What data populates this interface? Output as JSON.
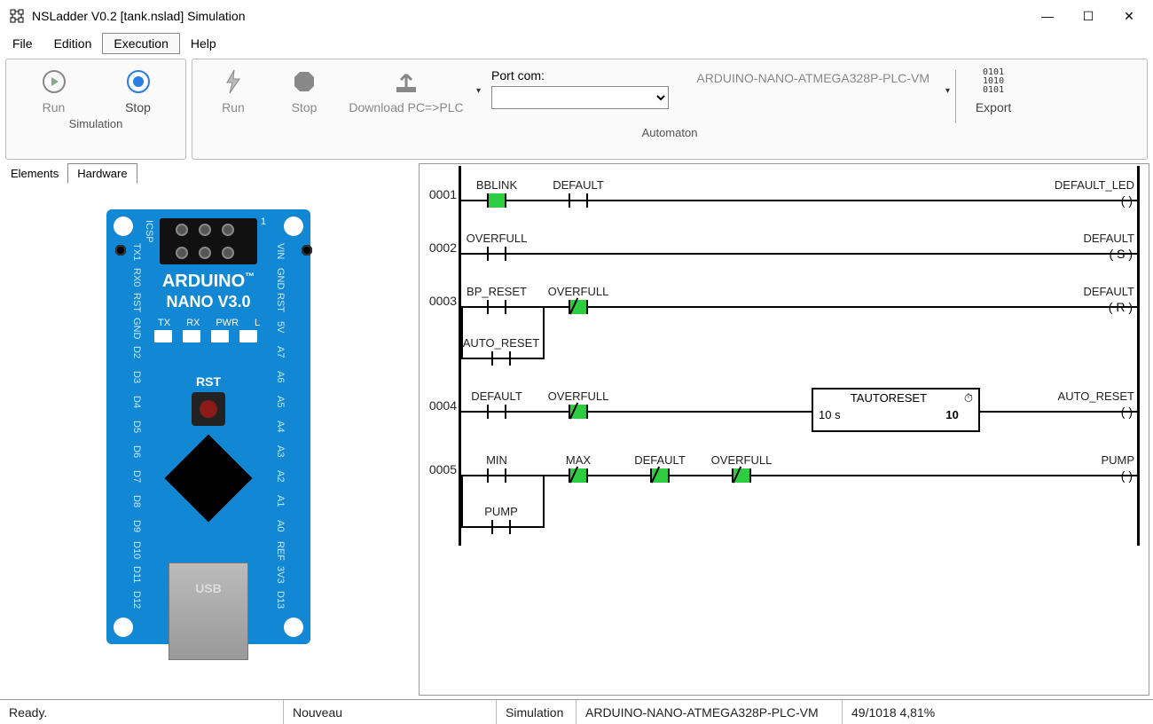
{
  "title": "NSLadder V0.2  [tank.nslad] Simulation",
  "menu": [
    "File",
    "Edition",
    "Execution",
    "Help"
  ],
  "menu_active": 2,
  "ribbon": {
    "sim": {
      "run": "Run",
      "stop": "Stop",
      "label": "Simulation"
    },
    "auto": {
      "run": "Run",
      "stop": "Stop",
      "download": "Download PC=>PLC",
      "portlbl": "Port com:",
      "hw": "ARDUINO-NANO-ATMEGA328P-PLC-VM",
      "export": "Export",
      "label": "Automaton"
    }
  },
  "tabs": [
    "Elements",
    "Hardware"
  ],
  "tab_active": 1,
  "board": {
    "name": "ARDUINO",
    "sub": "NANO V3.0",
    "rst": "RST",
    "usb": "USB",
    "tm": "™"
  },
  "ladder": {
    "rungs": [
      {
        "n": "0001",
        "left": [
          {
            "t": "NO",
            "lbl": "BBLINK",
            "on": true
          },
          {
            "t": "NO",
            "lbl": "DEFAULT"
          }
        ],
        "coil": {
          "t": "()",
          "lbl": "DEFAULT_LED"
        }
      },
      {
        "n": "0002",
        "left": [
          {
            "t": "NO",
            "lbl": "OVERFULL"
          }
        ],
        "coil": {
          "t": "(S)",
          "lbl": "DEFAULT"
        }
      },
      {
        "n": "0003",
        "left": [
          {
            "t": "NO",
            "lbl": "BP_RESET"
          },
          {
            "t": "NC",
            "lbl": "OVERFULL",
            "on": true
          }
        ],
        "branch": [
          {
            "t": "NO",
            "lbl": "AUTO_RESET"
          }
        ],
        "coil": {
          "t": "(R)",
          "lbl": "DEFAULT"
        }
      },
      {
        "n": "0004",
        "left": [
          {
            "t": "NO",
            "lbl": "DEFAULT"
          },
          {
            "t": "NC",
            "lbl": "OVERFULL",
            "on": true
          }
        ],
        "timer": {
          "name": "TAUTORESET",
          "set": "10 s",
          "val": "10"
        },
        "coil": {
          "t": "()",
          "lbl": "AUTO_RESET"
        }
      },
      {
        "n": "0005",
        "left": [
          {
            "t": "NO",
            "lbl": "MIN"
          },
          {
            "t": "NC",
            "lbl": "MAX",
            "on": true
          },
          {
            "t": "NC",
            "lbl": "DEFAULT",
            "on": true
          },
          {
            "t": "NC",
            "lbl": "OVERFULL",
            "on": true
          }
        ],
        "branch": [
          {
            "t": "NO",
            "lbl": "PUMP"
          }
        ],
        "coil": {
          "t": "()",
          "lbl": "PUMP"
        }
      }
    ]
  },
  "status": {
    "ready": "Ready.",
    "file": "Nouveau",
    "mode": "Simulation",
    "hw": "ARDUINO-NANO-ATMEGA328P-PLC-VM",
    "mem": "49/1018  4,81%"
  },
  "icons": {
    "min": "—",
    "max": "☐",
    "close": "✕"
  }
}
